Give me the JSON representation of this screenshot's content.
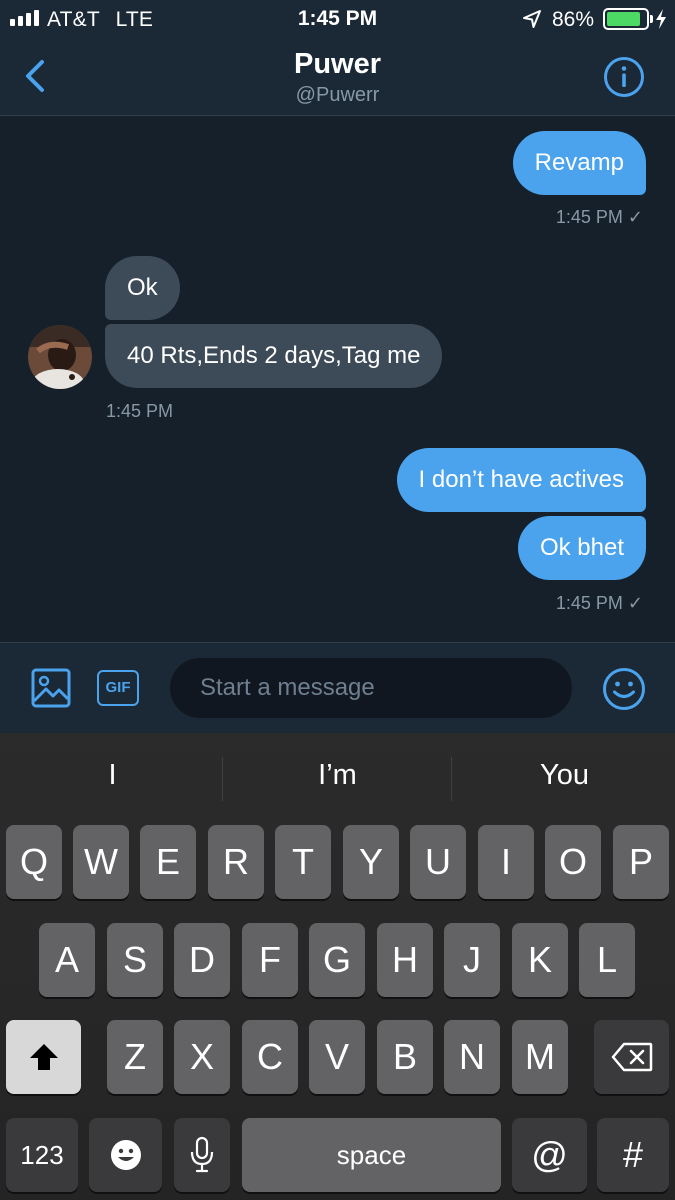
{
  "status_bar": {
    "carrier": "AT&T",
    "network": "LTE",
    "time": "1:45 PM",
    "battery_percent": "86%",
    "battery_level": 0.86,
    "icons": [
      "signal-bars-icon",
      "location-arrow-icon",
      "battery-icon",
      "charging-bolt-icon"
    ]
  },
  "header": {
    "name": "Puwer",
    "handle": "@Puwerr",
    "icons": [
      "back-chevron-icon",
      "info-icon"
    ]
  },
  "messages": [
    {
      "direction": "outgoing",
      "text": "Revamp"
    },
    {
      "direction": "outgoing_meta",
      "text": "1:45 PM ✓"
    },
    {
      "direction": "incoming",
      "text": "Ok"
    },
    {
      "direction": "incoming",
      "text": "40 Rts,Ends 2 days,Tag me"
    },
    {
      "direction": "incoming_meta",
      "text": "1:45 PM"
    },
    {
      "direction": "outgoing",
      "text": "I don’t have actives"
    },
    {
      "direction": "outgoing",
      "text": "Ok bhet"
    },
    {
      "direction": "outgoing_meta",
      "text": "1:45 PM ✓"
    }
  ],
  "composer": {
    "placeholder": "Start a message",
    "gif_label": "GIF",
    "icons": [
      "image-icon",
      "gif-icon",
      "emoji-icon"
    ]
  },
  "keyboard": {
    "suggestions": [
      "I",
      "I’m",
      "You"
    ],
    "row1": [
      "Q",
      "W",
      "E",
      "R",
      "T",
      "Y",
      "U",
      "I",
      "O",
      "P"
    ],
    "row2": [
      "A",
      "S",
      "D",
      "F",
      "G",
      "H",
      "J",
      "K",
      "L"
    ],
    "row3": [
      "Z",
      "X",
      "C",
      "V",
      "B",
      "N",
      "M"
    ],
    "numbers_key": "123",
    "space_key": "space",
    "at_key": "@",
    "hash_key": "#",
    "icons": [
      "shift-arrow-icon",
      "backspace-icon",
      "emoji-key-icon",
      "microphone-icon"
    ]
  },
  "colors": {
    "background": "#15202b",
    "outgoing_bubble": "#4aa3ec",
    "incoming_bubble": "#3d4a58",
    "accent": "#4aa3ec",
    "battery_green": "#4cd964"
  }
}
